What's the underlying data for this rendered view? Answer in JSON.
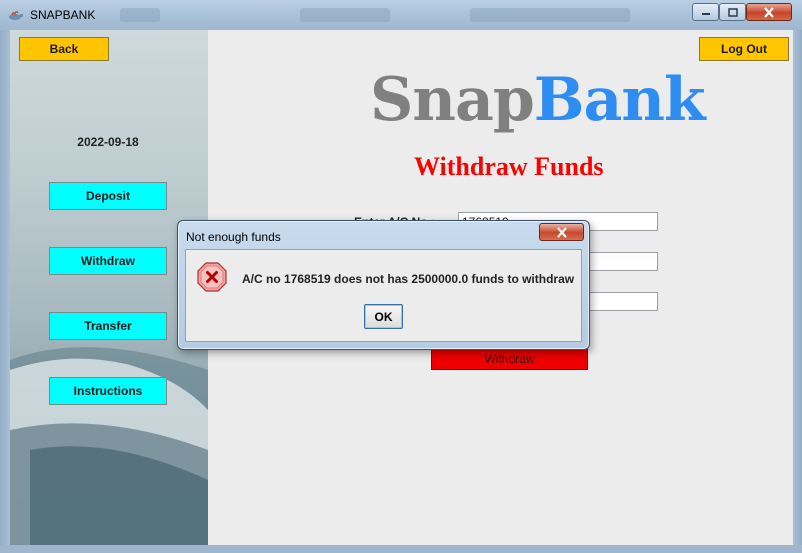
{
  "window": {
    "title": "SNAPBANK",
    "colors": {
      "titlebar": "#a8c0d8",
      "close": "#c7442a"
    }
  },
  "left_panel": {
    "back_label": "Back",
    "date": "2022-09-18",
    "nav": [
      {
        "label": "Deposit"
      },
      {
        "label": "Withdraw"
      },
      {
        "label": "Transfer"
      },
      {
        "label": "Instructions"
      }
    ],
    "colors": {
      "nav_button": "#00ffff",
      "back_button": "#ffc600"
    }
  },
  "header": {
    "logout_label": "Log Out",
    "logo_part1": "Snap",
    "logo_part2": "Bank",
    "page_title": "Withdraw Funds",
    "colors": {
      "logo_gray": "#808080",
      "logo_blue": "#2f8cf0",
      "title_red": "#ff0000"
    }
  },
  "form": {
    "account_label": "Enter A/C No :",
    "account_value": "1768519",
    "amount_value": "",
    "pin_value": "",
    "submit_label": "Withdraw",
    "colors": {
      "submit": "#ee0000"
    }
  },
  "dialog": {
    "title": "Not enough funds",
    "icon": "error-icon",
    "message": "A/C no 1768519 does not has 2500000.0 funds to withdraw",
    "ok_label": "OK"
  }
}
